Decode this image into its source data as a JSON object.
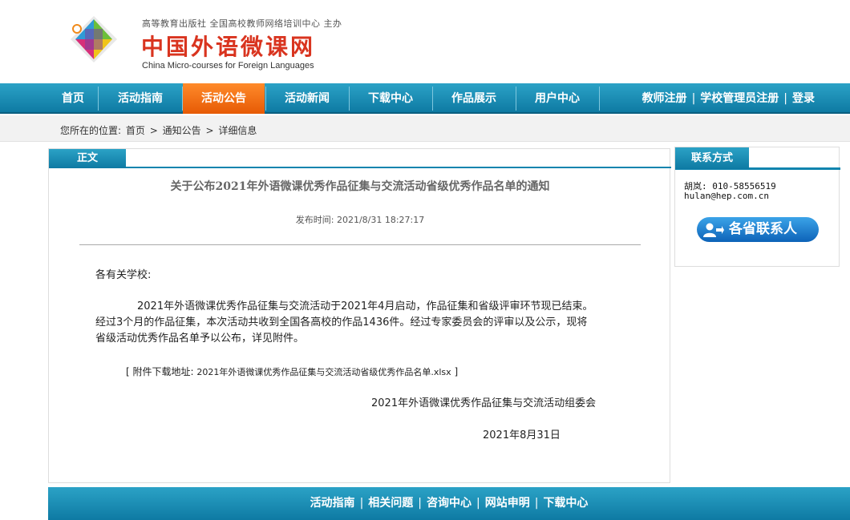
{
  "header": {
    "org": "高等教育出版社 全国高校教师网络培训中心 主办",
    "title": "中国外语微课网",
    "subtitle": "China Micro-courses for Foreign Languages"
  },
  "nav": {
    "items": [
      {
        "label": "首页"
      },
      {
        "label": "活动指南"
      },
      {
        "label": "活动公告",
        "active": true
      },
      {
        "label": "活动新闻"
      },
      {
        "label": "下载中心"
      },
      {
        "label": "作品展示"
      },
      {
        "label": "用户中心"
      }
    ],
    "right": [
      "教师注册",
      "学校管理员注册",
      "登录"
    ],
    "separator": "|"
  },
  "breadcrumb": {
    "prefix": "您所在的位置:",
    "items": [
      "首页",
      "通知公告",
      "详细信息"
    ],
    "arrow": ">"
  },
  "main": {
    "tab": "正文",
    "title": "关于公布2021年外语微课优秀作品征集与交流活动省级优秀作品名单的通知",
    "pubtime_label": "发布时间:",
    "pubtime": "2021/8/31 18:27:17",
    "greeting": "各有关学校:",
    "paragraph_lines": [
      "　　　　2021年外语微课优秀作品征集与交流活动于2021年4月启动，作品征集和省级评审环节现已结束。",
      "经过3个月的作品征集，本次活动共收到全国各高校的作品1436件。经过专家委员会的评审以及公示，现将",
      "省级活动优秀作品名单予以公布，详见附件。"
    ],
    "attachment_open": "[ 附件下载地址:",
    "attachment_link": "2021年外语微课优秀作品征集与交流活动省级优秀作品名单.xlsx",
    "attachment_close": "]",
    "signature": "2021年外语微课优秀作品征集与交流活动组委会",
    "date": "2021年8月31日"
  },
  "side": {
    "tab": "联系方式",
    "line1": "胡岚: 010-58556519",
    "line2": "hulan@hep.com.cn",
    "button": "各省联系人"
  },
  "footer": {
    "items": [
      "活动指南",
      "相关问题",
      "咨询中心",
      "网站申明",
      "下载中心"
    ],
    "separator": "|"
  },
  "colors": {
    "nav_blue": "#1790b8",
    "active_orange": "#f07010",
    "title_red": "#d9341f"
  }
}
